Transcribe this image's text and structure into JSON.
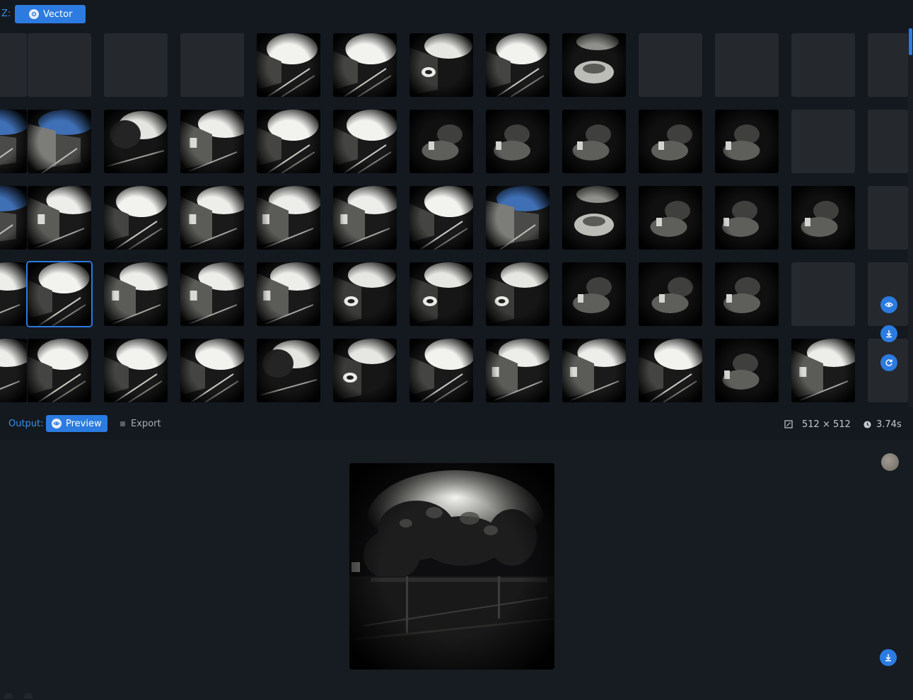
{
  "header": {
    "z_label": "Z:",
    "mode_button": {
      "label": "Vector",
      "icon": "vector-icon"
    }
  },
  "grid": {
    "columns": 12,
    "rows": 5,
    "selected": {
      "row": 3,
      "col": 1
    },
    "cells": [
      [
        "empty",
        "empty",
        "empty",
        "empty",
        "street-rails",
        "street-rails",
        "street-car",
        "street-rails",
        "car-street",
        "empty",
        "empty",
        "empty"
      ],
      [
        "sky-street",
        "sky-street",
        "tree-sky",
        "street-buildings",
        "street-rails",
        "street-rails",
        "dark-room",
        "dark-room",
        "dark-room",
        "dark-room",
        "dark-room",
        "empty"
      ],
      [
        "sky-street",
        "street-buildings",
        "street-rails",
        "street-buildings",
        "street-buildings",
        "street-buildings",
        "street-rails",
        "sky-street",
        "car-street",
        "dark-room",
        "dark-room",
        "dark-room"
      ],
      [
        "street-buildings",
        "street-rails",
        "street-buildings",
        "street-buildings",
        "street-buildings",
        "street-car",
        "street-car",
        "street-car",
        "dark-room",
        "dark-room",
        "dark-room",
        "empty"
      ],
      [
        "street-buildings",
        "street-rails",
        "street-rails",
        "street-rails",
        "tree-sky",
        "street-car",
        "street-rails",
        "street-buildings",
        "street-buildings",
        "street-rails",
        "dark-room",
        "street-buildings"
      ]
    ],
    "side_actions": [
      {
        "name": "compare",
        "icon": "eye-icon"
      },
      {
        "name": "download",
        "icon": "download-icon"
      },
      {
        "name": "refresh",
        "icon": "refresh-icon"
      }
    ]
  },
  "output": {
    "label": "Output:",
    "preview_tab": {
      "label": "Preview",
      "icon": "eye-icon"
    },
    "export_tab": {
      "label": "Export",
      "icon": "export-icon"
    },
    "dimensions": "512 × 512",
    "duration": "3.74s"
  },
  "colors": {
    "accent": "#2b7be0",
    "background": "#141920",
    "empty_cell": "#25282d"
  }
}
